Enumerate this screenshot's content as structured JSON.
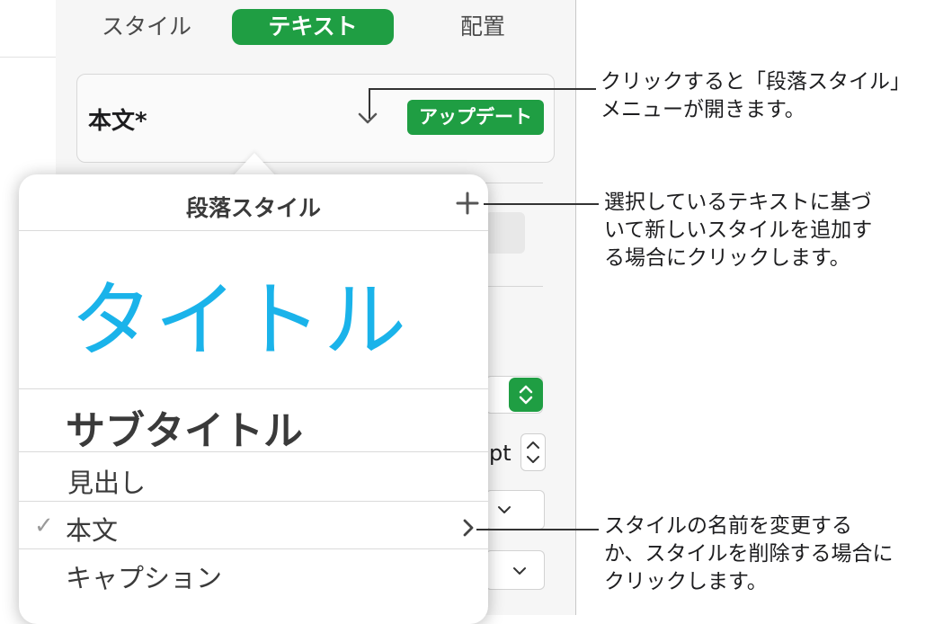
{
  "tabs": [
    {
      "label": "スタイル",
      "active": false
    },
    {
      "label": "テキスト",
      "active": true
    },
    {
      "label": "配置",
      "active": false
    }
  ],
  "paragraph_style": {
    "current": "本文*",
    "update_button": "アップデート"
  },
  "popover": {
    "title": "段落スタイル",
    "items": [
      {
        "label": "タイトル",
        "color": "#1ab3ea"
      },
      {
        "label": "サブタイトル"
      },
      {
        "label": "見出し"
      },
      {
        "label": "本文",
        "selected": true
      },
      {
        "label": "キャプション"
      }
    ]
  },
  "background": {
    "unit_label": "pt"
  },
  "callouts": {
    "menu": [
      "クリックすると「段落スタイル」",
      "メニューが開きます。"
    ],
    "add": [
      "選択しているテキストに基づ",
      "いて新しいスタイルを追加す",
      "る場合にクリックします。"
    ],
    "rename": [
      "スタイルの名前を変更する",
      "か、スタイルを削除する場合に",
      "クリックします。"
    ]
  },
  "colors": {
    "accent_green": "#1f9e43",
    "title_blue": "#1ab3ea"
  }
}
